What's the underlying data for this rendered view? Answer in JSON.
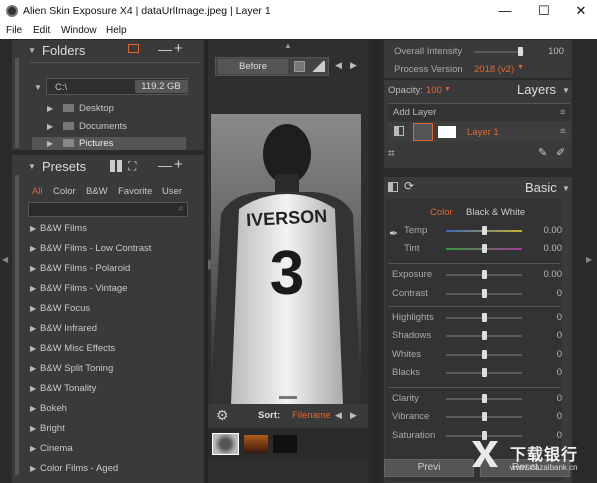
{
  "window": {
    "title": "Alien Skin Exposure X4 | dataUrlImage.jpeg | Layer 1",
    "min": "—",
    "max": "☐",
    "close": "✕"
  },
  "menu": [
    "File",
    "Edit",
    "Window",
    "Help"
  ],
  "folders": {
    "title": "Folders",
    "drive": "C:\\",
    "size": "119.2 GB",
    "items": [
      "Desktop",
      "Documents",
      "Pictures"
    ]
  },
  "presets": {
    "title": "Presets",
    "filters": [
      "All",
      "Color",
      "B&W",
      "Favorite",
      "User"
    ],
    "items": [
      "B&W Films",
      "B&W Films - Low Contrast",
      "B&W Films - Polaroid",
      "B&W Films - Vintage",
      "B&W Focus",
      "B&W Infrared",
      "B&W Misc Effects",
      "B&W Split Toning",
      "B&W Tonality",
      "Bokeh",
      "Bright",
      "Cinema",
      "Color Films - Aged"
    ]
  },
  "center": {
    "before": "Before",
    "jersey_name": "IVERSON",
    "jersey_number": "3",
    "sort_label": "Sort:",
    "sort_value": "Filename"
  },
  "right": {
    "overall_intensity": "Overall Intensity",
    "overall_value": "100",
    "process_version": "Process Version",
    "process_value": "2018 (v2)",
    "opacity_label": "Opacity:",
    "opacity_value": "100",
    "layers_title": "Layers",
    "add_layer": "Add Layer",
    "layer_name": "Layer 1",
    "basic_title": "Basic",
    "tab_color": "Color",
    "tab_bw": "Black & White",
    "adjustments": [
      {
        "label": "Temp",
        "value": "0.00",
        "pos": 0.5
      },
      {
        "label": "Tint",
        "value": "0.00",
        "pos": 0.5
      },
      {
        "label": "Exposure",
        "value": "0.00",
        "pos": 0.5
      },
      {
        "label": "Contrast",
        "value": "0",
        "pos": 0.5
      },
      {
        "label": "Highlights",
        "value": "0",
        "pos": 0.5
      },
      {
        "label": "Shadows",
        "value": "0",
        "pos": 0.5
      },
      {
        "label": "Whites",
        "value": "0",
        "pos": 0.5
      },
      {
        "label": "Blacks",
        "value": "0",
        "pos": 0.5
      },
      {
        "label": "Clarity",
        "value": "0",
        "pos": 0.5
      },
      {
        "label": "Vibrance",
        "value": "0",
        "pos": 0.5
      },
      {
        "label": "Saturation",
        "value": "0",
        "pos": 0.5
      }
    ],
    "preview": "Previ",
    "reset": "Reset"
  },
  "watermark": {
    "text": "下载银行",
    "url": "www.xiazaibank.cn"
  }
}
